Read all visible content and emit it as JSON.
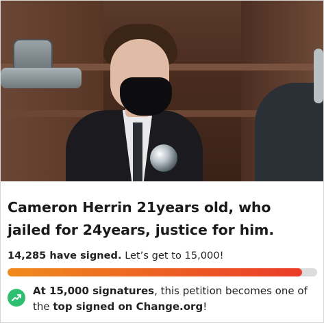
{
  "petition": {
    "title": "Cameron Herrin 21years old, who jailed for 24years, justice for him.",
    "signed_count": "14,285 have signed.",
    "goal_text": "Let’s get to 15,000!",
    "progress_fraction": 0.9523,
    "milestone": {
      "part1_bold": "At 15,000 signatures",
      "part2": ", this petition becomes one of the ",
      "part3_bold": "top signed on Change.org",
      "part4": "!"
    }
  },
  "colors": {
    "progress_start": "#f08a1c",
    "progress_end": "#ea3c29",
    "progress_track": "#dcdcdc",
    "milestone_icon_bg": "#2fbf71"
  },
  "icons": {
    "milestone": "trending-up-icon"
  }
}
